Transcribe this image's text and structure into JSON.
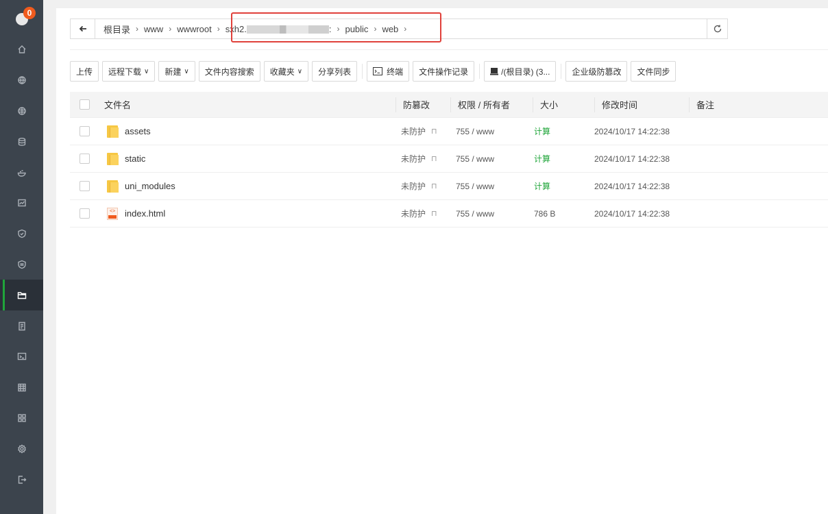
{
  "sidebar": {
    "badge_count": "0",
    "items": [
      {
        "icon": "home-icon"
      },
      {
        "icon": "globe-icon"
      },
      {
        "icon": "site-icon"
      },
      {
        "icon": "database-icon"
      },
      {
        "icon": "docker-icon"
      },
      {
        "icon": "monitor-icon"
      },
      {
        "icon": "shield-icon"
      },
      {
        "icon": "waf-icon"
      },
      {
        "icon": "folder-icon",
        "active": true
      },
      {
        "icon": "log-icon"
      },
      {
        "icon": "terminal-icon"
      },
      {
        "icon": "calendar-icon"
      },
      {
        "icon": "apps-icon"
      },
      {
        "icon": "settings-icon"
      },
      {
        "icon": "logout-icon"
      }
    ]
  },
  "address": {
    "crumbs": [
      "根目录",
      "www",
      "wwwroot",
      "sxh2.",
      "public",
      "web"
    ],
    "redacted_segment_suffix": ":"
  },
  "toolbar": {
    "upload": "上传",
    "remote_download": "远程下载",
    "new": "新建",
    "content_search": "文件内容搜索",
    "favorites": "收藏夹",
    "share_list": "分享列表",
    "terminal": "终端",
    "op_log": "文件操作记录",
    "disk": "/(根目录) (3...",
    "tamper_proof": "企业级防篡改",
    "sync": "文件同步"
  },
  "table": {
    "headers": {
      "name": "文件名",
      "protect": "防篡改",
      "perm": "权限 / 所有者",
      "size": "大小",
      "mtime": "修改时间",
      "note": "备注"
    },
    "rows": [
      {
        "type": "folder",
        "name": "assets",
        "protect": "未防护",
        "perm": "755 / www",
        "size": "计算",
        "mtime": "2024/10/17 14:22:38"
      },
      {
        "type": "folder",
        "name": "static",
        "protect": "未防护",
        "perm": "755 / www",
        "size": "计算",
        "mtime": "2024/10/17 14:22:38"
      },
      {
        "type": "folder",
        "name": "uni_modules",
        "protect": "未防护",
        "perm": "755 / www",
        "size": "计算",
        "mtime": "2024/10/17 14:22:38"
      },
      {
        "type": "html",
        "name": "index.html",
        "protect": "未防护",
        "perm": "755 / www",
        "size": "786 B",
        "mtime": "2024/10/17 14:22:38"
      }
    ]
  },
  "colors": {
    "accent": "#20a53a",
    "sidebar": "#3c444d",
    "highlight": "#e0403a"
  }
}
